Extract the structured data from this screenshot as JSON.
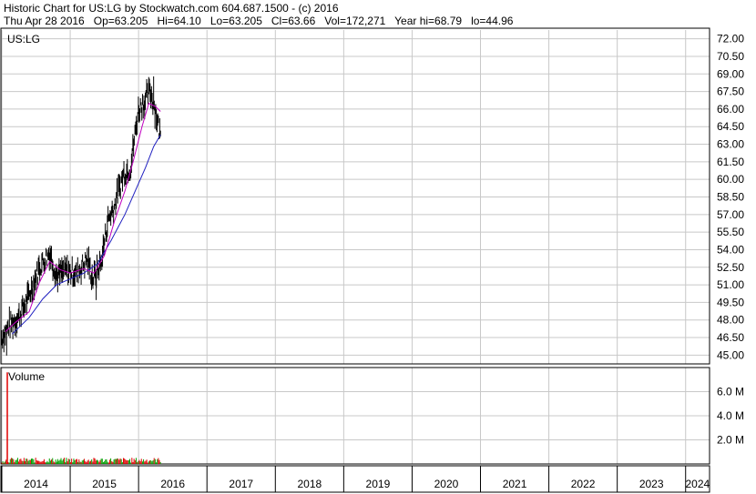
{
  "header": {
    "line1": "Historic Chart for US:LG by Stockwatch.com 604.687.1500 - (c) 2016",
    "line2": "Thu Apr 28 2016   Op=63.205   Hi=64.10   Lo=63.205   Cl=63.66   Vol=172,271   Year hi=68.79   lo=44.96"
  },
  "chart_data": [
    {
      "type": "line",
      "title": "US:LG",
      "grid": true,
      "ylim": [
        44.25,
        72.75
      ],
      "y_ticks": [
        "72.00",
        "70.50",
        "69.00",
        "67.50",
        "66.00",
        "64.50",
        "63.00",
        "61.50",
        "60.00",
        "58.50",
        "57.00",
        "55.50",
        "54.00",
        "52.50",
        "51.00",
        "49.50",
        "48.00",
        "46.50",
        "45.00"
      ],
      "x_ticks": [
        "2014",
        "2015",
        "2016",
        "2017",
        "2018",
        "2019",
        "2020",
        "2021",
        "2022",
        "2023",
        "2024"
      ],
      "xlim": [
        2014.0,
        2024.35
      ],
      "colors": {
        "price": "#000000",
        "ma_short": "#c000c0",
        "ma_long": "#2020c0"
      },
      "anchors": [
        [
          2014.0,
          46.5
        ],
        [
          2014.12,
          47.6
        ],
        [
          2014.25,
          48.3
        ],
        [
          2014.38,
          49.8
        ],
        [
          2014.55,
          52.5
        ],
        [
          2014.7,
          53.8
        ],
        [
          2014.8,
          51.8
        ],
        [
          2014.95,
          52.2
        ],
        [
          2015.1,
          52.0
        ],
        [
          2015.25,
          53.2
        ],
        [
          2015.33,
          51.5
        ],
        [
          2015.45,
          52.8
        ],
        [
          2015.55,
          56.5
        ],
        [
          2015.65,
          57.8
        ],
        [
          2015.78,
          60.5
        ],
        [
          2015.88,
          61.0
        ],
        [
          2016.0,
          66.0
        ],
        [
          2016.1,
          66.8
        ],
        [
          2016.17,
          67.6
        ],
        [
          2016.25,
          65.8
        ],
        [
          2016.32,
          63.66
        ]
      ],
      "ma_short": [
        [
          2014.05,
          47.0
        ],
        [
          2014.2,
          47.8
        ],
        [
          2014.4,
          48.7
        ],
        [
          2014.55,
          51.2
        ],
        [
          2014.7,
          53.0
        ],
        [
          2014.85,
          52.3
        ],
        [
          2015.0,
          52.0
        ],
        [
          2015.2,
          52.4
        ],
        [
          2015.35,
          52.0
        ],
        [
          2015.5,
          53.5
        ],
        [
          2015.65,
          56.5
        ],
        [
          2015.8,
          59.0
        ],
        [
          2015.92,
          61.5
        ],
        [
          2016.05,
          64.5
        ],
        [
          2016.15,
          66.5
        ],
        [
          2016.25,
          66.2
        ],
        [
          2016.32,
          65.8
        ]
      ],
      "ma_long": [
        [
          2014.15,
          46.8
        ],
        [
          2014.4,
          48.2
        ],
        [
          2014.6,
          49.8
        ],
        [
          2014.8,
          51.0
        ],
        [
          2015.0,
          51.5
        ],
        [
          2015.2,
          52.0
        ],
        [
          2015.4,
          52.8
        ],
        [
          2015.6,
          54.8
        ],
        [
          2015.8,
          57.0
        ],
        [
          2015.95,
          59.0
        ],
        [
          2016.1,
          61.0
        ],
        [
          2016.22,
          62.8
        ],
        [
          2016.32,
          63.8
        ]
      ],
      "events": [
        {
          "x": 2015.38,
          "y": 49.7
        },
        {
          "x": 2016.22,
          "y": 68.79
        },
        {
          "x": 2014.07,
          "y": 44.96
        }
      ]
    },
    {
      "type": "bar",
      "title": "Volume",
      "ylim": [
        0,
        8.0
      ],
      "y_ticks": [
        "6.0 M",
        "4.0 M",
        "2.0 M"
      ],
      "xlim": [
        2014.0,
        2024.35
      ],
      "spike": {
        "x": 2014.08,
        "value": 7.6
      },
      "typical_volume": 0.35,
      "colors": {
        "up": "#00a000",
        "down": "#e00000"
      }
    }
  ]
}
